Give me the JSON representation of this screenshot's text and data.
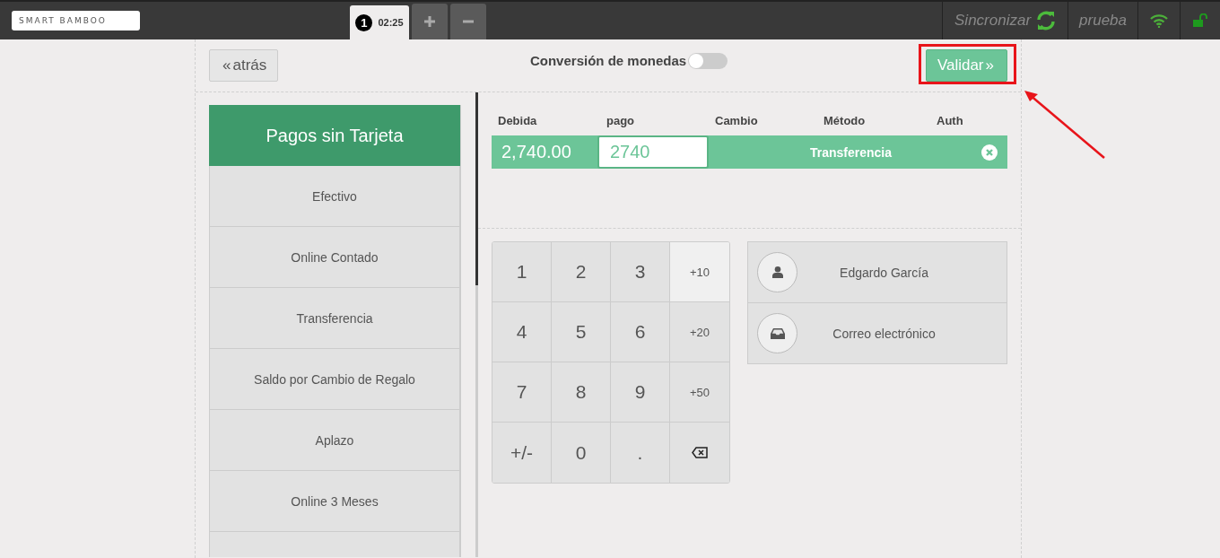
{
  "top_bar": {
    "logo": "SMART BAMBOO",
    "order_tabs": [
      {
        "number": "1",
        "time": "02:25",
        "selected": true
      }
    ],
    "sync_label": "Sincronizar",
    "user": "prueba"
  },
  "header": {
    "back_icon": "«",
    "back_button": "atrás",
    "validate_icon": "»",
    "currency_toggle": {
      "label": "Conversión de monedas",
      "on": false
    },
    "validate_button": "Validar"
  },
  "payment_methods": {
    "title": "Pagos sin Tarjeta",
    "items": [
      {
        "label": "Efectivo"
      },
      {
        "label": "Online Contado"
      },
      {
        "label": "Transferencia"
      },
      {
        "label": "Saldo por Cambio de Regalo"
      },
      {
        "label": "Aplazo"
      },
      {
        "label": "Online 3 Meses"
      }
    ]
  },
  "payment_lines": {
    "columns": [
      "Debida",
      "pago",
      "Cambio",
      "Método",
      "Auth"
    ],
    "rows": [
      {
        "due": "2,740.00",
        "payment": "2740",
        "method": "Transferencia",
        "selected": true
      }
    ]
  },
  "keypad": [
    {
      "kind": "digit",
      "label": "1",
      "selected": false
    },
    {
      "kind": "digit",
      "label": "2",
      "selected": false
    },
    {
      "kind": "digit",
      "label": "3",
      "selected": false
    },
    {
      "kind": "add",
      "label": "+10",
      "selected": true
    },
    {
      "kind": "digit",
      "label": "4",
      "selected": false
    },
    {
      "kind": "digit",
      "label": "5",
      "selected": false
    },
    {
      "kind": "digit",
      "label": "6",
      "selected": false
    },
    {
      "kind": "add",
      "label": "+20",
      "selected": false
    },
    {
      "kind": "digit",
      "label": "7",
      "selected": false
    },
    {
      "kind": "digit",
      "label": "8",
      "selected": false
    },
    {
      "kind": "digit",
      "label": "9",
      "selected": false
    },
    {
      "kind": "add",
      "label": "+50",
      "selected": false
    },
    {
      "kind": "digit",
      "label": "+/-",
      "selected": false
    },
    {
      "kind": "digit",
      "label": "0",
      "selected": false
    },
    {
      "kind": "digit",
      "label": ".",
      "selected": false
    },
    {
      "kind": "backspace",
      "selected": false
    }
  ],
  "customer_actions": [
    {
      "kind": "customer",
      "label": "Edgardo García"
    },
    {
      "kind": "email",
      "label": "Correo electrónico"
    }
  ]
}
